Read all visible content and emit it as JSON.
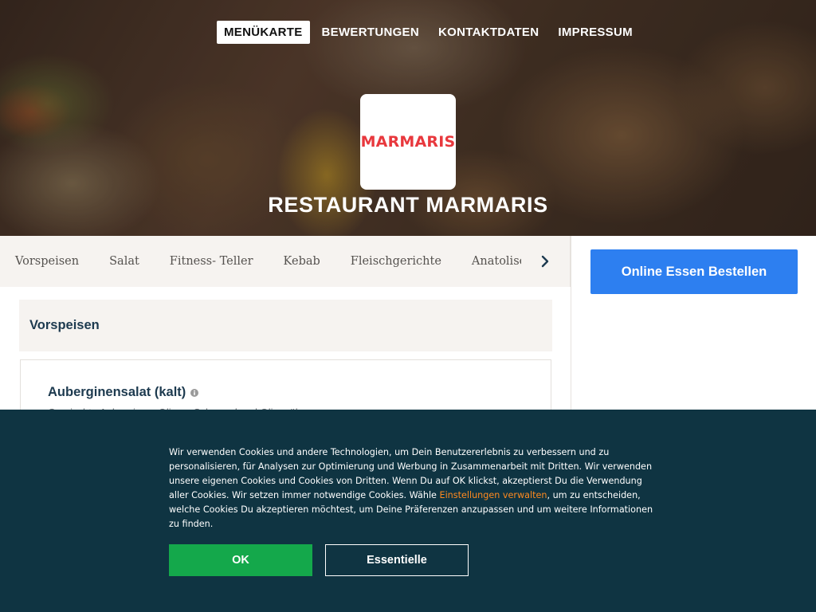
{
  "nav": {
    "items": [
      {
        "label": "MENÜKARTE",
        "active": true
      },
      {
        "label": "BEWERTUNGEN",
        "active": false
      },
      {
        "label": "KONTAKTDATEN",
        "active": false
      },
      {
        "label": "IMPRESSUM",
        "active": false
      }
    ]
  },
  "brand": {
    "logo_text": "MARMARIS",
    "logo_color": "#e8383d",
    "restaurant_name": "RESTAURANT MARMARIS"
  },
  "categories": {
    "items": [
      "Vorspeisen",
      "Salat",
      "Fitness- Teller",
      "Kebab",
      "Fleischgerichte",
      "Anatolische Spe"
    ],
    "next_icon": "chevron-right-icon"
  },
  "menu": {
    "section_title": "Vorspeisen",
    "dishes": [
      {
        "name": "Auberginensalat (kalt)",
        "info_icon": "info-icon",
        "description": "Gemischte Auberginen, Oliven, Schmand und Olivenöl"
      }
    ]
  },
  "sidebar": {
    "order_button": "Online Essen Bestellen",
    "accent": "#2d7ff0"
  },
  "cookie": {
    "text_before_link": "Wir verwenden Cookies und andere Technologien, um Dein Benutzererlebnis zu verbessern und zu personalisieren, für Analysen zur Optimierung und Werbung in Zusammenarbeit mit Dritten. Wir verwenden unsere eigenen Cookies und Cookies von Dritten. Wenn Du auf OK klickst, akzeptierst Du die Verwendung aller Cookies. Wir setzen immer notwendige Cookies. Wähle ",
    "link_text": "Einstellungen verwalten",
    "text_after_link": ", um zu entscheiden, welche Cookies Du akzeptieren möchtest, um Deine Präferenzen anzupassen und um weitere Informationen zu finden.",
    "ok_button": "OK",
    "essential_button": "Essentielle",
    "ok_color": "#14a84b",
    "background": "#0f3442",
    "link_color": "#ff8a1f"
  }
}
